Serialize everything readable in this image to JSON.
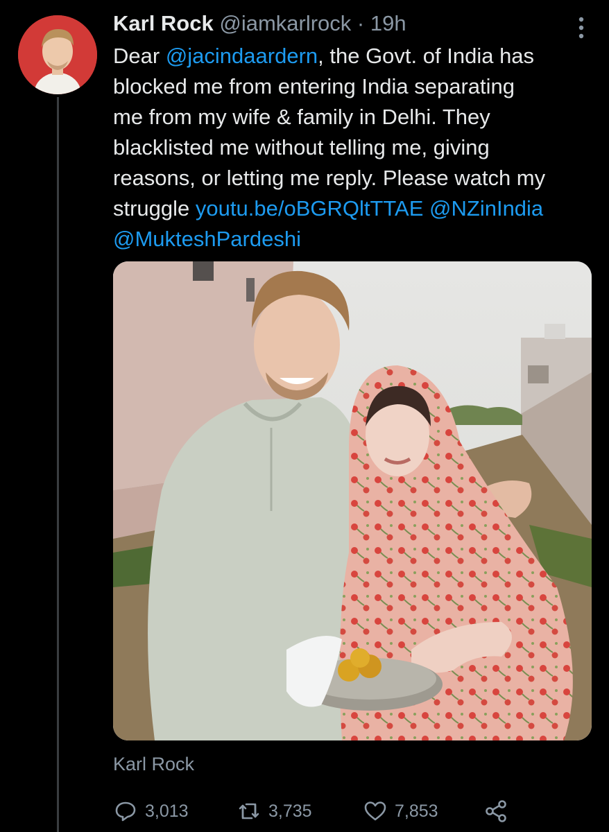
{
  "tweet": {
    "author_name": "Karl Rock",
    "handle": "@iamkarlrock",
    "separator": "·",
    "timestamp": "19h",
    "more_icon": "more-vertical-icon",
    "text_lines": [
      [
        {
          "t": "Dear "
        },
        {
          "t": "@jacindaardern",
          "link": true
        },
        {
          "t": ", the Govt. of India has"
        }
      ],
      [
        {
          "t": "blocked me from entering India separating"
        }
      ],
      [
        {
          "t": "me from my wife & family in Delhi. They"
        }
      ],
      [
        {
          "t": "blacklisted me without telling me, giving"
        }
      ],
      [
        {
          "t": "reasons, or letting me reply. Please watch my"
        }
      ],
      [
        {
          "t": "struggle "
        },
        {
          "t": "youtu.be/oBGRQltTTAE",
          "link": true
        },
        {
          "t": " "
        },
        {
          "t": "@NZinIndia",
          "link": true
        }
      ],
      [
        {
          "t": "@MukteshPardeshi",
          "link": true
        }
      ]
    ],
    "media_caption": "Karl Rock",
    "actions": {
      "reply_count": "3,013",
      "retweet_count": "3,735",
      "like_count": "7,853"
    }
  },
  "colors": {
    "background": "#000000",
    "text": "#e7e9ea",
    "secondary": "#8b98a5",
    "link": "#1d9bf0",
    "avatar_bg": "#d23a37"
  }
}
